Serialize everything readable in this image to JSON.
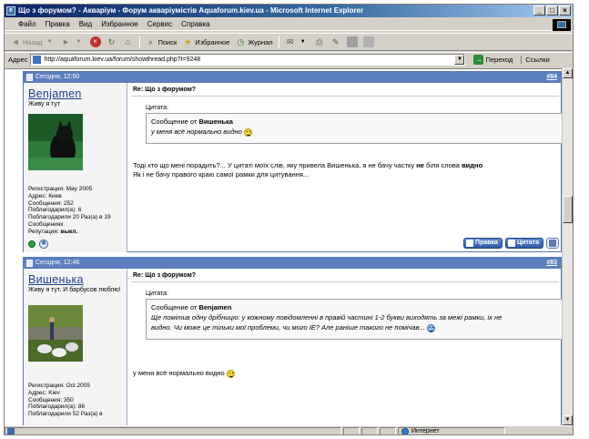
{
  "window": {
    "title": "Що з форумом? - Акваріум - Форум акваріумістів Aquaforum.kiev.ua - Microsoft Internet Explorer",
    "controls": {
      "minimize": "_",
      "maximize": "□",
      "close": "×"
    }
  },
  "menu": [
    "Файл",
    "Правка",
    "Вид",
    "Избранное",
    "Сервис",
    "Справка"
  ],
  "toolbar": {
    "back": "Назад",
    "search": "Поиск",
    "favorites": "Избранное",
    "journal": "Журнал"
  },
  "address": {
    "label": "Адрес",
    "url": "http://aquaforum.kiev.ua/forum/showthread.php?t=9248",
    "go": "Переход",
    "links": "Ссылки"
  },
  "posts": [
    {
      "date": "Сегодня, 12:50",
      "number": "#84",
      "username": "Benjamen",
      "user_title": "Живу я тут",
      "info": [
        {
          "label": "Регистрация:",
          "value": "May 2005"
        },
        {
          "label": "Адрес:",
          "value": "Киев"
        },
        {
          "label": "Сообщения:",
          "value": "252"
        },
        {
          "label": "Поблагодарил(а):",
          "value": "6"
        },
        {
          "label": "Поблагодарили",
          "value": "20 Раз(а) в 19 Сообщениях"
        }
      ],
      "reputation_label": "Репутация:",
      "reputation_value": "выкл.",
      "title": "Re: Що з форумом?",
      "quote_label": "Цитата:",
      "quote_prefix": "Сообщение от",
      "quote_author": "Вишенька",
      "quote_text": "у меня всё нормально видно",
      "text_line1_a": "Тоді хто що мені порадить?... У цитаті моїх слів, яку привела Вишенька, я не бачу частку ",
      "text_line1_b": "не",
      "text_line1_c": " біля слова ",
      "text_line1_d": "видно",
      "text_line2": "Як і не бачу правого краю самої рамки для цитування...",
      "actions": {
        "edit": "Правка",
        "quote": "Цитата"
      }
    },
    {
      "date": "Сегодня, 12:46",
      "number": "#83",
      "username": "Вишенька",
      "user_title": "Живу я тут. И барбусов люблю!",
      "info": [
        {
          "label": "Регистрация:",
          "value": "Oct 2005"
        },
        {
          "label": "Адрес:",
          "value": "Kiev"
        },
        {
          "label": "Сообщения:",
          "value": "350"
        },
        {
          "label": "Поблагодарил(а):",
          "value": "86"
        },
        {
          "label": "Поблагодарили",
          "value": "52 Раз(а) в"
        }
      ],
      "title": "Re: Що з форумом?",
      "quote_label": "Цитата:",
      "quote_prefix": "Сообщение от",
      "quote_author": "Benjamen",
      "quote_line1": "Ще помітив одну дрібницю: у кожному повідомленні в правій частині 1-2 букви виходять за межі рамки, іх не",
      "quote_line2": "видно. Чи може це тільки мої проблеми, чи мого IE? Але раніше такого не помічав...",
      "text": "у меня всё нормально видно"
    }
  ],
  "status": {
    "zone": "Интернет"
  },
  "colors": {
    "title_bar": "#0a246a",
    "post_header": "#5b7fbf",
    "username": "#1a3f8a",
    "window_chrome": "#d4d0c8"
  }
}
